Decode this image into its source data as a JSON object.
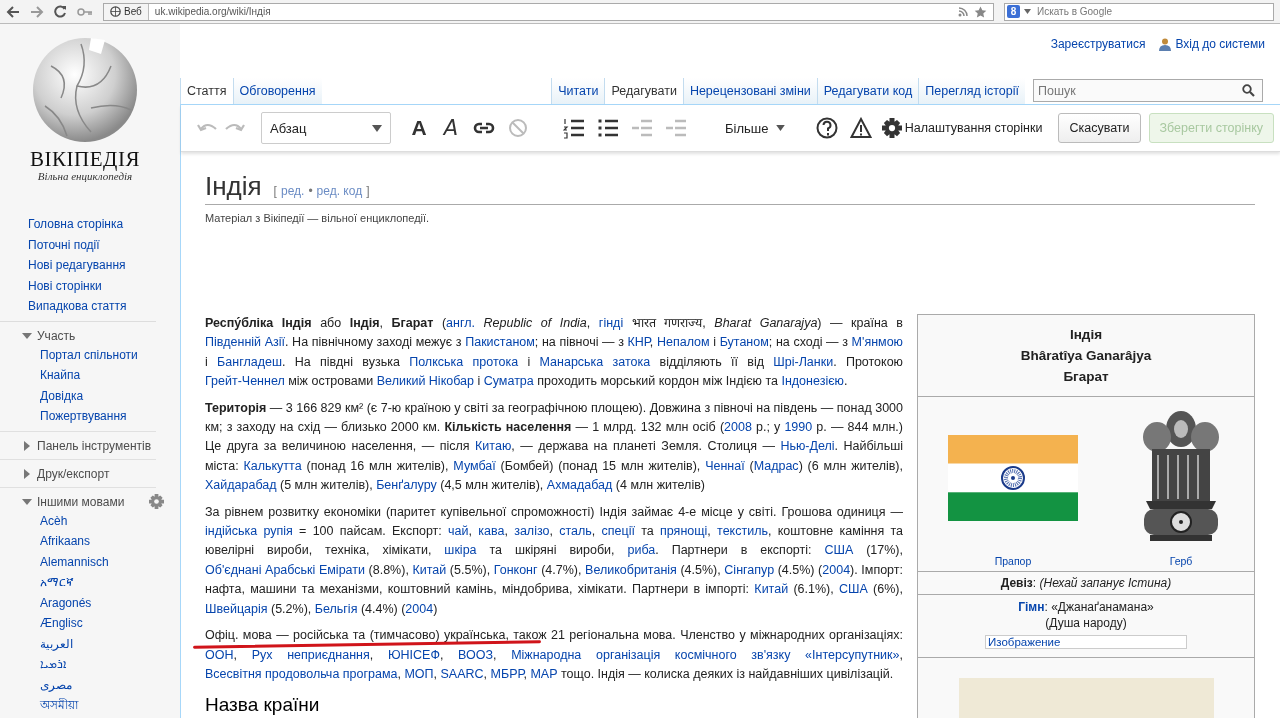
{
  "browser": {
    "site_badge": "Веб",
    "url": "uk.wikipedia.org/wiki/Індія",
    "engine_label": "8",
    "search_placeholder": "Искать в Google"
  },
  "logo": {
    "wordmark": "ВІКІПЕДІЯ",
    "tagline": "Вільна енциклопедія"
  },
  "sidebar": {
    "main": [
      "Головна сторінка",
      "Поточні події",
      "Нові редагування",
      "Нові сторінки",
      "Випадкова стаття"
    ],
    "sections": [
      {
        "title": "Участь",
        "expanded": true,
        "settings": false,
        "items": [
          "Портал спільноти",
          "Кнайпа",
          "Довідка",
          "Пожертвування"
        ]
      },
      {
        "title": "Панель інструментів",
        "expanded": false,
        "settings": false
      },
      {
        "title": "Друк/експорт",
        "expanded": false,
        "settings": false
      },
      {
        "title": "Іншими мовами",
        "expanded": true,
        "settings": true,
        "items": [
          "Acèh",
          "Afrikaans",
          "Alemannisch",
          "አማርኛ",
          "Aragonés",
          "Ænglisc",
          "العربية",
          "ܐܪܡܝܐ",
          "مصرى",
          "অসমীয়া"
        ]
      }
    ]
  },
  "personal": [
    {
      "kind": "register",
      "label": "Зареєструватися"
    },
    {
      "kind": "login",
      "label": "Вхід до системи"
    }
  ],
  "left_tabs": [
    {
      "label": "Стаття",
      "selected": true
    },
    {
      "label": "Обговорення",
      "selected": false
    }
  ],
  "right_tabs": [
    {
      "label": "Читати",
      "selected": false
    },
    {
      "label": "Редагувати",
      "selected": true
    },
    {
      "label": "Нерецензовані зміни",
      "selected": false
    },
    {
      "label": "Редагувати код",
      "selected": false
    },
    {
      "label": "Перегляд історії",
      "selected": false
    }
  ],
  "search": {
    "placeholder": "Пошук"
  },
  "toolbar": {
    "tools": [
      {
        "kind": "undo",
        "disabled": true
      },
      {
        "kind": "redo",
        "disabled": true
      },
      {
        "kind": "format",
        "label": "Абзац",
        "disabled": false
      },
      {
        "kind": "bold",
        "label": "A",
        "disabled": false
      },
      {
        "kind": "italic",
        "label": "A",
        "disabled": false
      },
      {
        "kind": "link",
        "disabled": false
      },
      {
        "kind": "clear",
        "disabled": true
      },
      {
        "kind": "numbered-list",
        "disabled": false
      },
      {
        "kind": "bullet-list",
        "disabled": false
      },
      {
        "kind": "outdent",
        "disabled": true
      },
      {
        "kind": "indent",
        "disabled": true
      },
      {
        "kind": "more",
        "label": "Більше",
        "disabled": false
      },
      {
        "kind": "help",
        "disabled": false
      },
      {
        "kind": "notices",
        "disabled": false
      },
      {
        "kind": "page-settings",
        "label": "Налаштування сторінки",
        "disabled": false
      }
    ],
    "cancel": "Скасувати",
    "save": {
      "label": "Зберегти сторінку",
      "disabled": true
    }
  },
  "article": {
    "title": "Індія",
    "edit_open": "[",
    "edit_link": "ред.",
    "edit_sep": "•",
    "edit_source": "ред. код",
    "edit_close": "]",
    "tagline": "Матеріал з Вікіпедії — вільної енциклопедії.",
    "paragraphs": [
      [
        {
          "kind": "text",
          "t": "**Респу́бліка Індія** або **Індія**, **Бгарат** ("
        },
        {
          "kind": "link",
          "t": "англ."
        },
        {
          "kind": "text",
          "t": " *Republic of India*, "
        },
        {
          "kind": "link",
          "t": "гінді"
        },
        {
          "kind": "text",
          "t": " भारत गणराज्य, *Bharat Ganarajya*) — країна в "
        },
        {
          "kind": "link",
          "t": "Південній Азії"
        },
        {
          "kind": "text",
          "t": ". На північному заході межує з "
        },
        {
          "kind": "link",
          "t": "Пакистаном"
        },
        {
          "kind": "text",
          "t": "; на півночі — з "
        },
        {
          "kind": "link",
          "t": "КНР"
        },
        {
          "kind": "text",
          "t": ", "
        },
        {
          "kind": "link",
          "t": "Непалом"
        },
        {
          "kind": "text",
          "t": " і "
        },
        {
          "kind": "link",
          "t": "Бутаном"
        },
        {
          "kind": "text",
          "t": "; на сході — з "
        },
        {
          "kind": "link",
          "t": "М'янмою"
        },
        {
          "kind": "text",
          "t": " і "
        },
        {
          "kind": "link",
          "t": "Бангладеш"
        },
        {
          "kind": "text",
          "t": ". На півдні вузька "
        },
        {
          "kind": "link",
          "t": "Полкська протока"
        },
        {
          "kind": "text",
          "t": " і "
        },
        {
          "kind": "link",
          "t": "Манарська затока"
        },
        {
          "kind": "text",
          "t": " відділяють її від "
        },
        {
          "kind": "link",
          "t": "Шрі-Ланки"
        },
        {
          "kind": "text",
          "t": ". Протокою "
        },
        {
          "kind": "link",
          "t": "Грейт-Ченнел"
        },
        {
          "kind": "text",
          "t": " між островами "
        },
        {
          "kind": "link",
          "t": "Великий Нікобар"
        },
        {
          "kind": "text",
          "t": " і "
        },
        {
          "kind": "link",
          "t": "Суматра"
        },
        {
          "kind": "text",
          "t": " проходить морський кордон між Індією та "
        },
        {
          "kind": "link",
          "t": "Індонезією"
        },
        {
          "kind": "text",
          "t": "."
        }
      ],
      [
        {
          "kind": "text",
          "t": "**Територія** — 3 166 829 км² (є 7-ю країною у світі за географічною площею). Довжина з півночі на південь — понад 3000 км; з заходу на схід — близько 2000 км. **Кількість населення** — 1 млрд. 132 млн осіб ("
        },
        {
          "kind": "link",
          "t": "2008"
        },
        {
          "kind": "text",
          "t": " р.; у "
        },
        {
          "kind": "link",
          "t": "1990"
        },
        {
          "kind": "text",
          "t": " р. — 844 млн.) Це друга за величиною населення, — після "
        },
        {
          "kind": "link",
          "t": "Китаю"
        },
        {
          "kind": "text",
          "t": ", — держава на планеті Земля. Столиця — "
        },
        {
          "kind": "link",
          "t": "Нью-Делі"
        },
        {
          "kind": "text",
          "t": ". Найбільші міста: "
        },
        {
          "kind": "link",
          "t": "Калькутта"
        },
        {
          "kind": "text",
          "t": " (понад 16 млн жителів), "
        },
        {
          "kind": "link",
          "t": "Мумбаї"
        },
        {
          "kind": "text",
          "t": " (Бомбей) (понад 15 млн жителів), "
        },
        {
          "kind": "link",
          "t": "Ченнаї"
        },
        {
          "kind": "text",
          "t": " ("
        },
        {
          "kind": "link",
          "t": "Мадрас"
        },
        {
          "kind": "text",
          "t": ") (6 млн жителів), "
        },
        {
          "kind": "link",
          "t": "Хайдарабад"
        },
        {
          "kind": "text",
          "t": " (5 млн жителів), "
        },
        {
          "kind": "link",
          "t": "Бенґалуру"
        },
        {
          "kind": "text",
          "t": " (4,5 млн жителів), "
        },
        {
          "kind": "link",
          "t": "Ахмадабад"
        },
        {
          "kind": "text",
          "t": " (4 млн жителів)"
        }
      ],
      [
        {
          "kind": "text",
          "t": "За рівнем розвитку економіки (паритет купівельної спроможності) Індія займає 4-е місце у світі. Грошова одиниця — "
        },
        {
          "kind": "link",
          "t": "індійська рупія"
        },
        {
          "kind": "text",
          "t": " = 100 пайсам. Експорт: "
        },
        {
          "kind": "link",
          "t": "чай"
        },
        {
          "kind": "text",
          "t": ", "
        },
        {
          "kind": "link",
          "t": "кава"
        },
        {
          "kind": "text",
          "t": ", "
        },
        {
          "kind": "link",
          "t": "залізо"
        },
        {
          "kind": "text",
          "t": ", "
        },
        {
          "kind": "link",
          "t": "сталь"
        },
        {
          "kind": "text",
          "t": ", "
        },
        {
          "kind": "link",
          "t": "спеції"
        },
        {
          "kind": "text",
          "t": " та "
        },
        {
          "kind": "link",
          "t": "прянощі"
        },
        {
          "kind": "text",
          "t": ", "
        },
        {
          "kind": "link",
          "t": "текстиль"
        },
        {
          "kind": "text",
          "t": ", коштовне каміння та ювелірні вироби, техніка, хімікати, "
        },
        {
          "kind": "link",
          "t": "шкіра"
        },
        {
          "kind": "text",
          "t": " та шкіряні вироби, "
        },
        {
          "kind": "link",
          "t": "риба"
        },
        {
          "kind": "text",
          "t": ". Партнери в експорті: "
        },
        {
          "kind": "link",
          "t": "США"
        },
        {
          "kind": "text",
          "t": " (17%), "
        },
        {
          "kind": "link",
          "t": "Об'єднані Арабські Емірати"
        },
        {
          "kind": "text",
          "t": " (8.8%), "
        },
        {
          "kind": "link",
          "t": "Китай"
        },
        {
          "kind": "text",
          "t": " (5.5%), "
        },
        {
          "kind": "link",
          "t": "Гонконг"
        },
        {
          "kind": "text",
          "t": " (4.7%), "
        },
        {
          "kind": "link",
          "t": "Великобританія"
        },
        {
          "kind": "text",
          "t": " (4.5%), "
        },
        {
          "kind": "link",
          "t": "Сінгапур"
        },
        {
          "kind": "text",
          "t": " (4.5%) ("
        },
        {
          "kind": "link",
          "t": "2004"
        },
        {
          "kind": "text",
          "t": "). Імпорт: нафта, машини та механізми, коштовний камінь, міндобрива, хімікати. Партнери в імпорті: "
        },
        {
          "kind": "link",
          "t": "Китай"
        },
        {
          "kind": "text",
          "t": " (6.1%), "
        },
        {
          "kind": "link",
          "t": "США"
        },
        {
          "kind": "text",
          "t": " (6%), "
        },
        {
          "kind": "link",
          "t": "Швейцарія"
        },
        {
          "kind": "text",
          "t": " (5.2%), "
        },
        {
          "kind": "link",
          "t": "Бельгія"
        },
        {
          "kind": "text",
          "t": " (4.4%) ("
        },
        {
          "kind": "link",
          "t": "2004"
        },
        {
          "kind": "text",
          "t": ")"
        }
      ],
      [
        {
          "kind": "text",
          "t": "Офіц. мова — російська та (тимчасово) українська, також 21 регіональна мова. Членство у міжнародних організаціях: "
        },
        {
          "kind": "link",
          "t": "ООН"
        },
        {
          "kind": "text",
          "t": ", "
        },
        {
          "kind": "link",
          "t": "Рух неприєднання"
        },
        {
          "kind": "text",
          "t": ", "
        },
        {
          "kind": "link",
          "t": "ЮНІСЕФ"
        },
        {
          "kind": "text",
          "t": ", "
        },
        {
          "kind": "link",
          "t": "ВООЗ"
        },
        {
          "kind": "text",
          "t": ", "
        },
        {
          "kind": "link",
          "t": "Міжнародна організація космічного зв'язку «Інтерсупутник»"
        },
        {
          "kind": "text",
          "t": ", "
        },
        {
          "kind": "link",
          "t": "Всесвітня продовольча програма"
        },
        {
          "kind": "text",
          "t": ", "
        },
        {
          "kind": "link",
          "t": "МОП"
        },
        {
          "kind": "text",
          "t": ", "
        },
        {
          "kind": "link",
          "t": "SAARC"
        },
        {
          "kind": "text",
          "t": ", "
        },
        {
          "kind": "link",
          "t": "МБРР"
        },
        {
          "kind": "text",
          "t": ", "
        },
        {
          "kind": "link",
          "t": "МАР"
        },
        {
          "kind": "text",
          "t": " тощо. Індія — колиска деяких із найдавніших цивілізацій."
        }
      ]
    ],
    "section_heading": "Назва країни"
  },
  "infobox": {
    "titles": [
      "Індія",
      "Bhâratîya Ganarâjya",
      "Бгарат"
    ],
    "flag_caption": "Прапор",
    "emblem_caption": "Герб",
    "motto": "**Девіз**: *(Нехай запанує Істина)*",
    "anthem_link": "Гімн",
    "anthem_rest": ": «Джанаґанамана»",
    "anthem_translation": "(Душа народу)",
    "anthem_media": "Изображение"
  }
}
